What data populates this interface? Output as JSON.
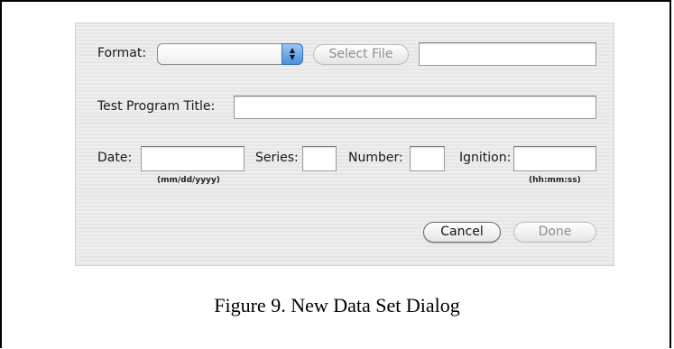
{
  "dialog": {
    "format_label": "Format:",
    "format_value": "",
    "select_file_label": "Select File",
    "file_path_value": "",
    "test_program_title_label": "Test Program Title:",
    "test_program_title_value": "",
    "date_label": "Date:",
    "date_value": "",
    "date_hint": "(mm/dd/yyyy)",
    "series_label": "Series:",
    "series_value": "",
    "number_label": "Number:",
    "number_value": "",
    "ignition_label": "Ignition:",
    "ignition_value": "",
    "ignition_hint": "(hh:mm:ss)",
    "cancel_label": "Cancel",
    "done_label": "Done",
    "popup_icon": "up-down-arrows-icon"
  },
  "caption": "Figure 9.  New Data Set Dialog"
}
